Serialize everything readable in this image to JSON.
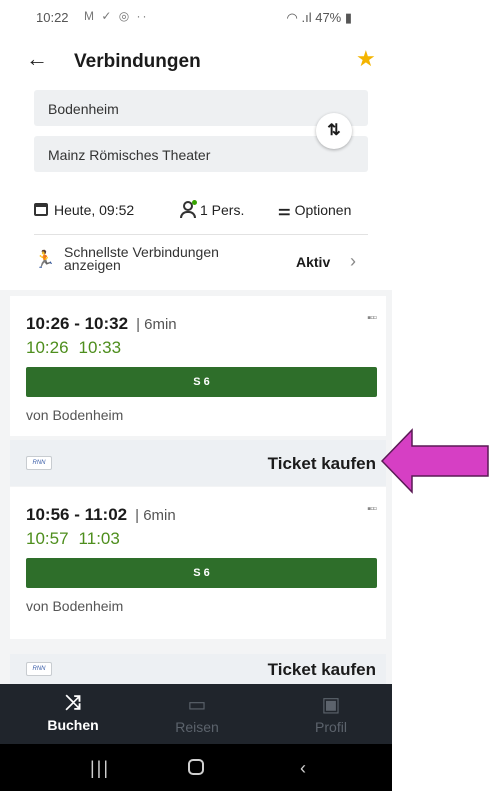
{
  "status_bar": {
    "time": "10:22",
    "notifications": "M ✓ ◎ ··",
    "system": "◠ .ıl 47% ▮"
  },
  "header": {
    "title": "Verbindungen",
    "back_icon": "←",
    "favorite_icon": "★"
  },
  "search": {
    "from": "Bodenheim",
    "to": "Mainz Römisches Theater",
    "swap_icon": "⇅",
    "date": "Heute, 09:52",
    "persons": "1 Pers.",
    "options": "Optionen",
    "options_icon": "⚌",
    "fastest_label": "Schnellste Verbindungen anzeigen",
    "fastest_status": "Aktiv",
    "runner_icon": "🏃",
    "chevron": "›"
  },
  "connections": [
    {
      "times": "10:26 - 10:32",
      "duration": "| 6min",
      "realtime_dep": "10:26",
      "realtime_arr": "10:33",
      "line": "S 6",
      "from": "von Bodenheim",
      "crowd": "▪▫▫",
      "ticket_label": "Ticket kaufen",
      "logo_text": "RNN"
    },
    {
      "times": "10:56 - 11:02",
      "duration": "| 6min",
      "realtime_dep": "10:57",
      "realtime_arr": "11:03",
      "line": "S 6",
      "from": "von Bodenheim",
      "crowd": "▪▫▫",
      "ticket_label": "Ticket kaufen",
      "logo_text": "RNN"
    }
  ],
  "bottom_nav": {
    "items": [
      {
        "label": "Buchen",
        "icon": "⤨"
      },
      {
        "label": "Reisen",
        "icon": "▭"
      },
      {
        "label": "Profil",
        "icon": "▣"
      }
    ]
  },
  "android_nav": {
    "recent": "|||",
    "back": "‹"
  },
  "colors": {
    "line_bar": "#2e6e2a",
    "realtime": "#4e8e1d",
    "arrow": "#d63fc4",
    "nav_bg": "#20252c",
    "star": "#f4b400"
  }
}
